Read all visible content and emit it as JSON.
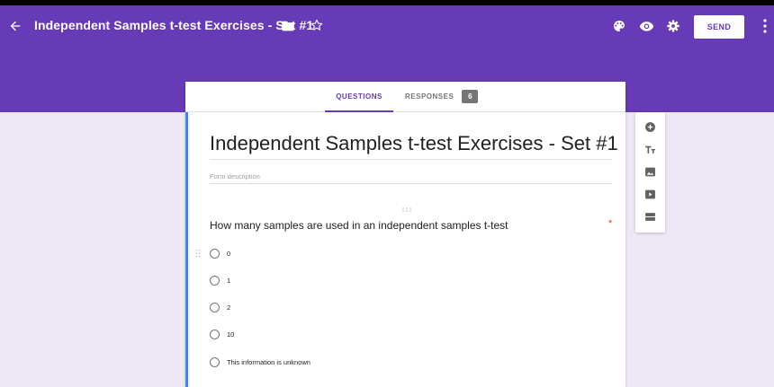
{
  "header": {
    "title": "Independent Samples t-test Exercises - Set #1",
    "send_label": "SEND",
    "icons": [
      "back-arrow-icon",
      "folder-icon",
      "star-icon",
      "palette-icon",
      "eye-icon",
      "gear-icon",
      "more-vert-icon"
    ]
  },
  "tabs": {
    "questions_label": "QUESTIONS",
    "responses_label": "RESPONSES",
    "responses_count": "6"
  },
  "form": {
    "title": "Independent Samples t-test Exercises - Set #1",
    "description_placeholder": "Form description"
  },
  "question": {
    "text": "How many samples are used in an independent samples t-test",
    "required_mark": "*",
    "options": [
      "0",
      "1",
      "2",
      "10",
      "This information is unknown"
    ]
  },
  "toolbar": {
    "icons": [
      "add-question-icon",
      "add-title-icon",
      "add-image-icon",
      "add-video-icon",
      "add-section-icon"
    ]
  },
  "colors": {
    "header": "#673ab7",
    "background": "#ede7f6",
    "accent": "#4285f4",
    "required": "#db4437"
  }
}
